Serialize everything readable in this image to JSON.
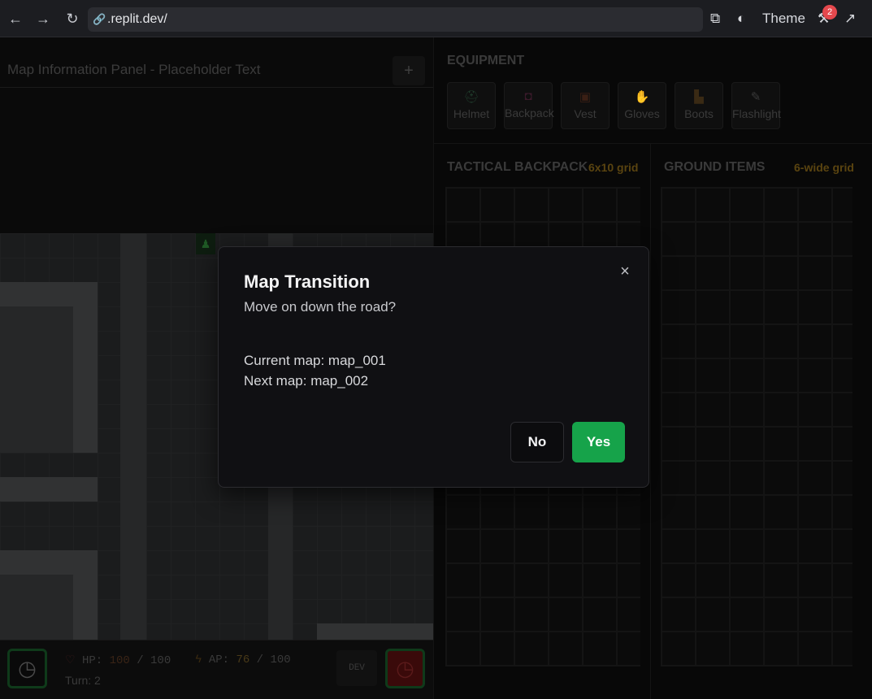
{
  "browser": {
    "url": ".replit.dev/",
    "theme_label": "Theme",
    "badge_count": "2",
    "icons": [
      "back-arrow-icon",
      "forward-arrow-icon",
      "reload-icon",
      "link-icon",
      "devices-icon",
      "palette-icon",
      "wrench-icon",
      "external-link-icon"
    ]
  },
  "left_panel": {
    "title": "Map Information Panel - Placeholder Text",
    "add_label": "+"
  },
  "status": {
    "hp_label": "HP:",
    "hp_value": "100",
    "hp_max": "100",
    "ap_label": "AP:",
    "ap_value": "76",
    "ap_max": "100",
    "slash": "/",
    "turn": "Turn: 2",
    "dev_label": "DEV"
  },
  "equipment": {
    "title": "EQUIPMENT",
    "slots": [
      {
        "label": "Helmet",
        "icon": "helmet-icon"
      },
      {
        "label": "Backpack",
        "icon": "backpack-icon"
      },
      {
        "label": "Vest",
        "icon": "vest-icon"
      },
      {
        "label": "Gloves",
        "icon": "gloves-icon"
      },
      {
        "label": "Boots",
        "icon": "boots-icon"
      },
      {
        "label": "Flashlight",
        "icon": "flashlight-icon"
      }
    ]
  },
  "backpack": {
    "title": "TACTICAL BACKPACK",
    "grid_note": "6x10 grid"
  },
  "ground": {
    "title": "GROUND ITEMS",
    "grid_note": "6-wide grid"
  },
  "modal": {
    "title": "Map Transition",
    "subtitle": "Move on down the road?",
    "current_map": "Current map: map_001",
    "next_map": "Next map: map_002",
    "no_label": "No",
    "yes_label": "Yes",
    "close_label": "×"
  },
  "colors": {
    "accent_green": "#16a34a",
    "badge_red": "#e5484d"
  }
}
